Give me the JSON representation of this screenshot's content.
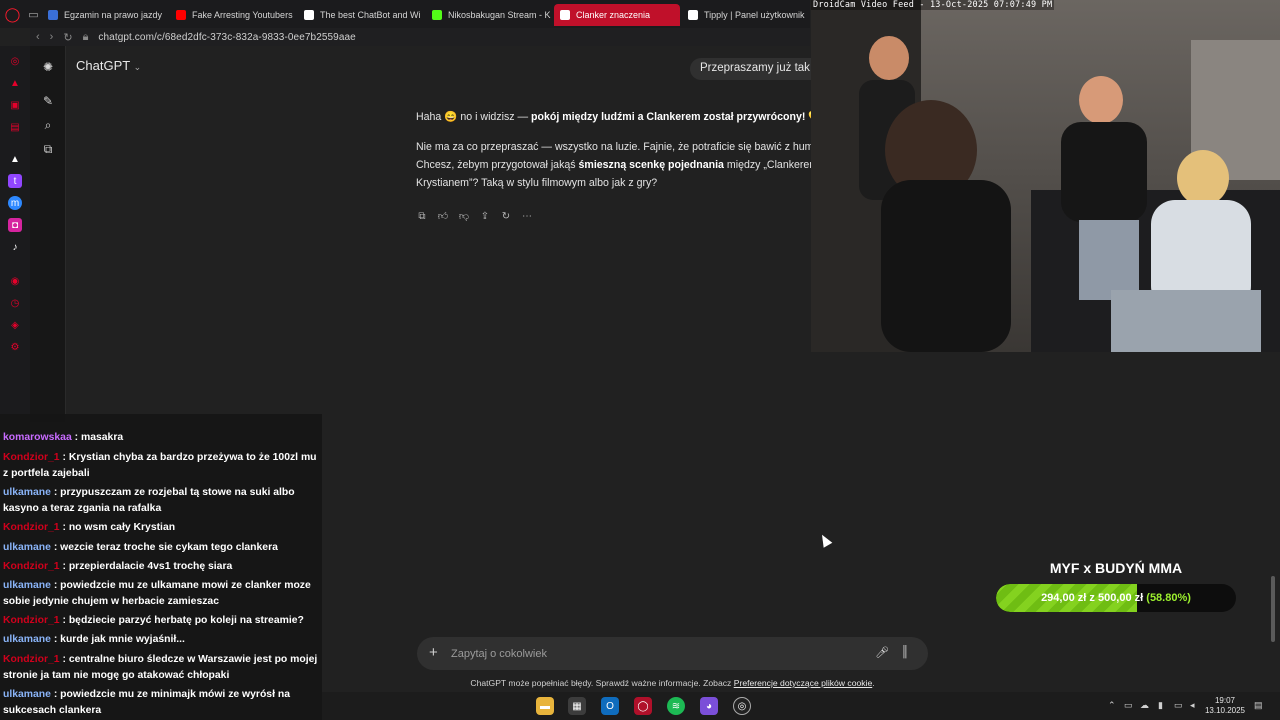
{
  "browser": {
    "tabs": [
      {
        "label": "Egzamin na prawo jazdy",
        "fav_color": "#3a6fd8"
      },
      {
        "label": "Fake Arresting Youtubers",
        "fav_color": "#ff0000"
      },
      {
        "label": "The best ChatBot and Wi",
        "fav_color": "#ffffff"
      },
      {
        "label": "Nikosbakugan Stream - K",
        "fav_color": "#53fc18"
      },
      {
        "label": "Clanker znaczenia",
        "fav_color": "#ffffff",
        "active": true
      },
      {
        "label": "Tipply | Panel użytkownik",
        "fav_color": "#ffffff"
      }
    ],
    "url": "chatgpt.com/c/68ed2dfc-373c-832a-9833-0ee7b2559aae"
  },
  "chatgpt": {
    "model_label": "ChatGPT",
    "user_message": "Przepraszamy już tak ni",
    "line1_pre": "Haha 😄 no i widzisz — ",
    "line1_bold": "pokój między ludźmi a Clankerem został przywrócony!",
    "line1_post": " 💛",
    "line2": "Nie ma za co przepraszać — wszystko na luzie. Fajnie, że potraficie się bawić z humo",
    "line3_pre": "Chcesz, żebym przygotował jakąś ",
    "line3_bold": "śmieszną scenkę pojednania",
    "line3_post": " między „Clankerem”",
    "line4": "Krystianem”? Taką w stylu filmowym albo jak z gry?",
    "composer_placeholder": "Zapytaj o cokolwiek",
    "disclaimer_text": "ChatGPT może popełniać błędy. Sprawdź ważne informacje. Zobacz ",
    "disclaimer_link": "Preferencje dotyczące plików cookie",
    "disclaimer_end": "."
  },
  "webcam": {
    "label": "DroidCam Video Feed - 13-Oct-2025 07:07:49 PM"
  },
  "chat_messages": [
    {
      "user": "komarowskaa",
      "color": "#c86bff",
      "text": "masakra"
    },
    {
      "user": "Kondzior_1",
      "color": "#d0001c",
      "text": "Krystian chyba za bardzo przeżywa to że 100zl mu z portfela zajebali"
    },
    {
      "user": "ulkamane",
      "color": "#8ab4f8",
      "text": "przypuszczam ze rozjebal tą stowe na suki albo kasyno a teraz zgania na rafalka"
    },
    {
      "user": "Kondzior_1",
      "color": "#d0001c",
      "text": "no wsm cały Krystian"
    },
    {
      "user": "ulkamane",
      "color": "#8ab4f8",
      "text": "wezcie teraz troche sie cykam tego clankera"
    },
    {
      "user": "Kondzior_1",
      "color": "#d0001c",
      "text": "przepierdalacie 4vs1 trochę siara"
    },
    {
      "user": "ulkamane",
      "color": "#8ab4f8",
      "text": "powiedzcie mu ze ulkamane mowi ze clanker moze sobie jedynie chujem w herbacie zamieszac"
    },
    {
      "user": "Kondzior_1",
      "color": "#d0001c",
      "text": "będziecie parzyć herbatę po koleji na streamie?"
    },
    {
      "user": "ulkamane",
      "color": "#8ab4f8",
      "text": "kurde jak mnie wyjaśnił..."
    },
    {
      "user": "Kondzior_1",
      "color": "#d0001c",
      "text": "centralne biuro śledcze w Warszawie jest po mojej stronie ja tam nie mogę go atakować chłopaki"
    },
    {
      "user": "ulkamane",
      "color": "#8ab4f8",
      "text": "powiedzcie mu ze minimajk mówi ze wyrósł na sukcesach clankera"
    }
  ],
  "goal": {
    "title": "MYF x BUDYŃ MMA",
    "current": "294,00 zł",
    "separator": "z",
    "target": "500,00 zł",
    "percent_label": "(58.80%)",
    "progress": 0.588
  },
  "taskbar": {
    "time": "19:07",
    "date": "13.10.2025"
  }
}
